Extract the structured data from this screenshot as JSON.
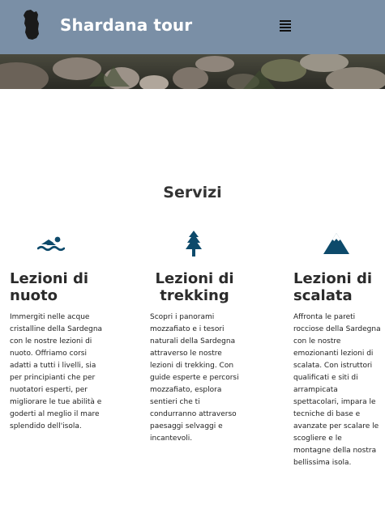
{
  "navbar": {
    "brand_name": "Shardana tour",
    "logo_icon": "sardinia-island-icon",
    "menu_icon": "hamburger-menu-icon",
    "background_color": "#7a8fa6"
  },
  "hero": {
    "image": "rocky-landscape-image"
  },
  "services": {
    "title": "Servizi",
    "accent_color": "#0d4a6b",
    "items": [
      {
        "icon": "swimmer-icon",
        "title": "Lezioni di nuoto",
        "description": "Immergiti nelle acque cristalline della Sardegna con le nostre lezioni di nuoto. Offriamo corsi adatti a tutti i livelli, sia per principianti che per nuotatori esperti, per migliorare le tue abilità e goderti al meglio il mare splendido dell'isola."
      },
      {
        "icon": "pine-tree-icon",
        "title": "Lezioni di trekking",
        "description": "Scopri i panorami mozzafiato e i tesori naturali della Sardegna attraverso le nostre lezioni di trekking. Con guide esperte e percorsi mozzafiato, esplora sentieri che ti condurranno attraverso paesaggi selvaggi e incantevoli."
      },
      {
        "icon": "mountain-icon",
        "title": "Lezioni di scalata",
        "description": "Affronta le pareti rocciose della Sardegna con le nostre emozionanti lezioni di scalata. Con istruttori qualificati e siti di arrampicata spettacolari, impara le tecniche di base e avanzate per scalare le scogliere e le montagne della nostra bellissima isola."
      }
    ]
  }
}
